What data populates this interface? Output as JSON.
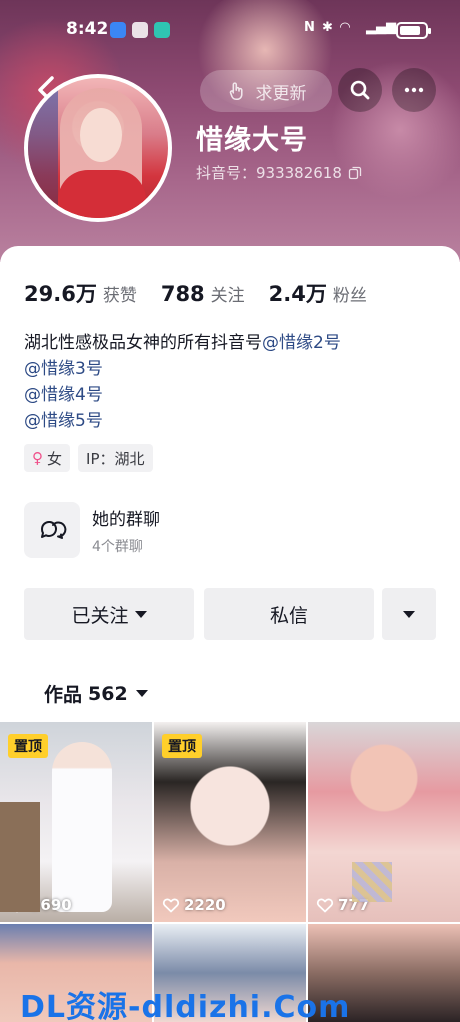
{
  "status_bar": {
    "time": "8:42"
  },
  "nav": {
    "update_label": "求更新"
  },
  "profile": {
    "name": "惜缘大号",
    "douyin_id": "抖音号：933382618"
  },
  "stats": [
    {
      "value": "29.6万",
      "label": "获赞"
    },
    {
      "value": "788",
      "label": "关注"
    },
    {
      "value": "2.4万",
      "label": "粉丝"
    }
  ],
  "bio": {
    "line1": "湖北性感极品女神的所有抖音号",
    "mentions": [
      "@惜缘2号",
      "@惜缘3号",
      "@惜缘4号",
      "@惜缘5号"
    ]
  },
  "tags": {
    "gender": "女",
    "ip": "IP：湖北"
  },
  "group_chat": {
    "title": "她的群聊",
    "subtitle": "4个群聊"
  },
  "actions": {
    "follow_label": "已关注",
    "message_label": "私信"
  },
  "works": {
    "label": "作品",
    "count": "562"
  },
  "grid": [
    {
      "pinned_label": "置顶",
      "likes": "5690"
    },
    {
      "pinned_label": "置顶",
      "likes": "2220"
    },
    {
      "pinned_label": "",
      "likes": "777"
    }
  ],
  "watermark": "DL资源-dldizhi.Com",
  "colors": {
    "mention": "#2d4a85",
    "pin": "#ffcf2b",
    "banner": "#8e4a72"
  }
}
